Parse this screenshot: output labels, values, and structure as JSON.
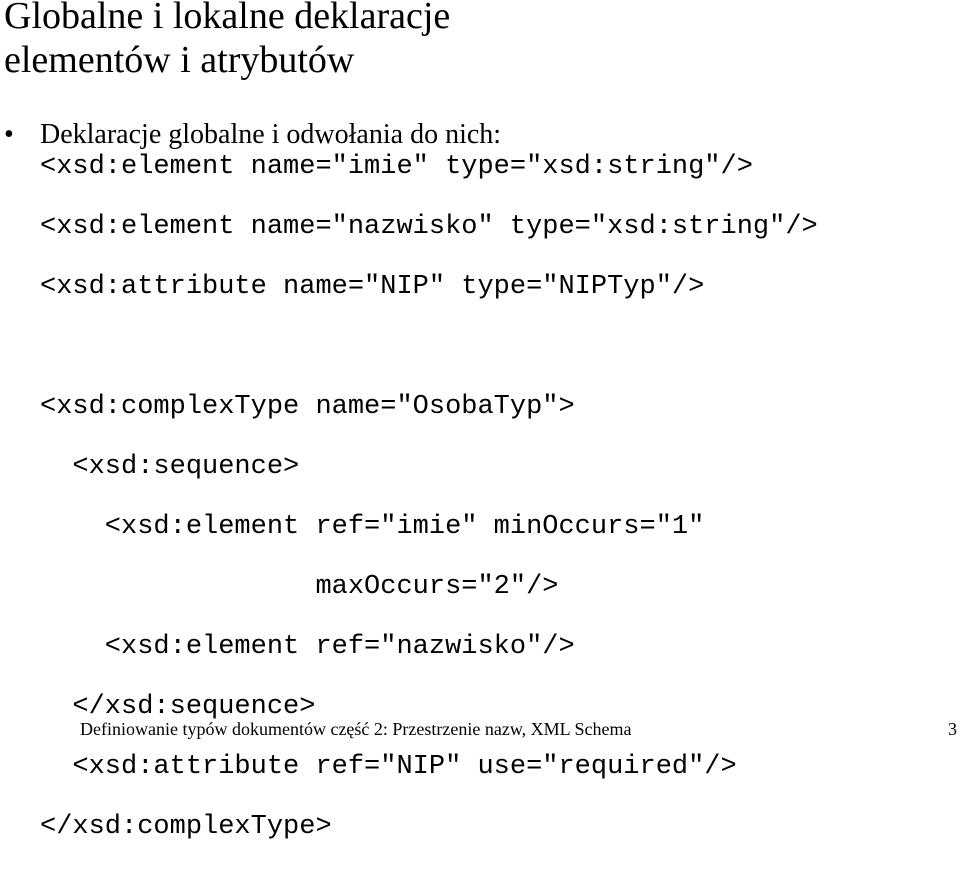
{
  "slide": {
    "title_line1": "Globalne i lokalne deklaracje",
    "title_line2": "elementów i atrybutów",
    "bullet_symbol": "•",
    "bullet_text": "Deklaracje globalne i odwołania do nich:"
  },
  "code_lines": [
    "<xsd:element name=\"imie\" type=\"xsd:string\"/>",
    "<xsd:element name=\"nazwisko\" type=\"xsd:string\"/>",
    "<xsd:attribute name=\"NIP\" type=\"NIPTyp\"/>",
    "",
    "<xsd:complexType name=\"OsobaTyp\">",
    "  <xsd:sequence>",
    "    <xsd:element ref=\"imie\" minOccurs=\"1\"",
    "                 maxOccurs=\"2\"/>",
    "    <xsd:element ref=\"nazwisko\"/>",
    "  </xsd:sequence>",
    "  <xsd:attribute ref=\"NIP\" use=\"required\"/>",
    "</xsd:complexType>"
  ],
  "footer": {
    "text": "Definiowanie typów dokumentów  część 2: Przestrzenie nazw, XML Schema",
    "page_number": "3"
  }
}
